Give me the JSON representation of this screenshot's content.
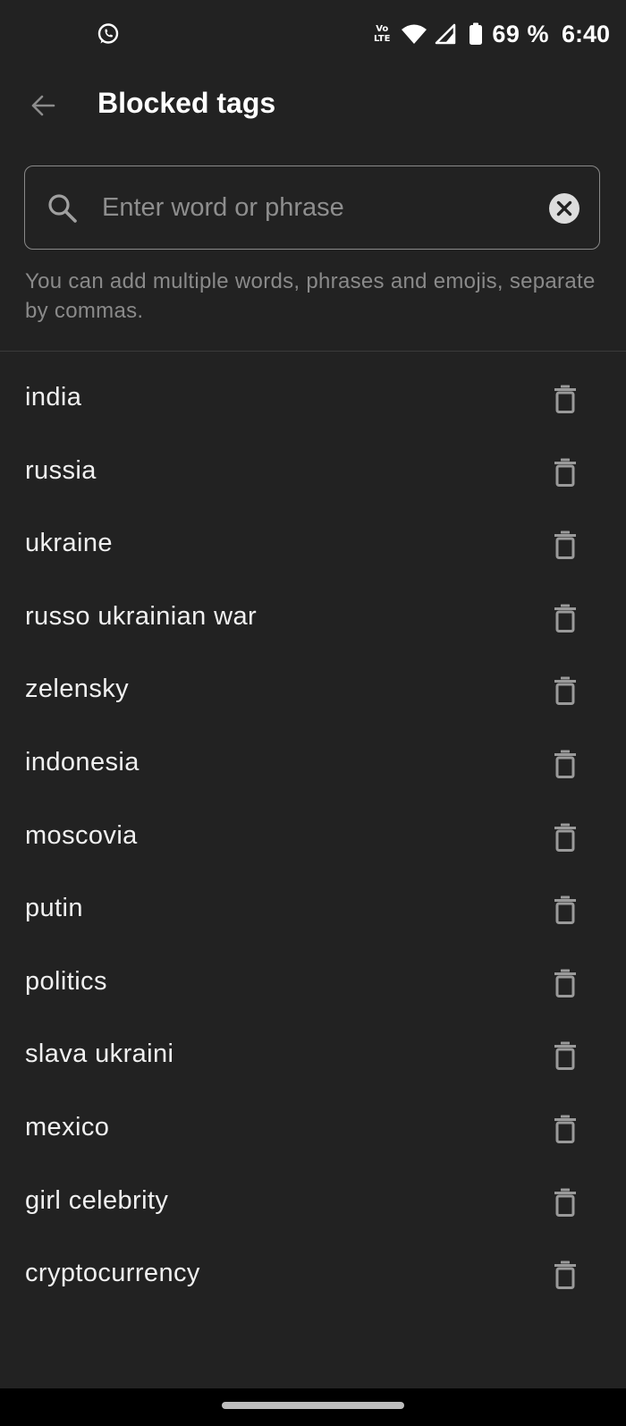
{
  "status_bar": {
    "volte_top": "Vo",
    "volte_bottom": "LTE",
    "battery_percent": "69 %",
    "time": "6:40",
    "icons": [
      "whatsapp-icon",
      "volte-icon",
      "wifi-icon",
      "signal-icon",
      "battery-icon"
    ]
  },
  "app_bar": {
    "title": "Blocked tags",
    "back_icon": "arrow-left-icon"
  },
  "search": {
    "value": "",
    "placeholder": "Enter word or phrase",
    "icon": "search-icon",
    "clear_icon": "close-circle-icon"
  },
  "helper": {
    "text": "You can add multiple words, phrases and emojis, separate by commas."
  },
  "tags": [
    {
      "label": "india"
    },
    {
      "label": "russia"
    },
    {
      "label": "ukraine"
    },
    {
      "label": "russo ukrainian war"
    },
    {
      "label": "zelensky"
    },
    {
      "label": "indonesia"
    },
    {
      "label": "moscovia"
    },
    {
      "label": "putin"
    },
    {
      "label": "politics"
    },
    {
      "label": "slava ukraini"
    },
    {
      "label": "mexico"
    },
    {
      "label": "girl celebrity"
    },
    {
      "label": "cryptocurrency"
    }
  ],
  "colors": {
    "background": "#222222",
    "text_primary": "#f0f0f0",
    "text_secondary": "#8a8a8a",
    "icon": "#9a9a9a",
    "nav_bar": "#000000"
  }
}
